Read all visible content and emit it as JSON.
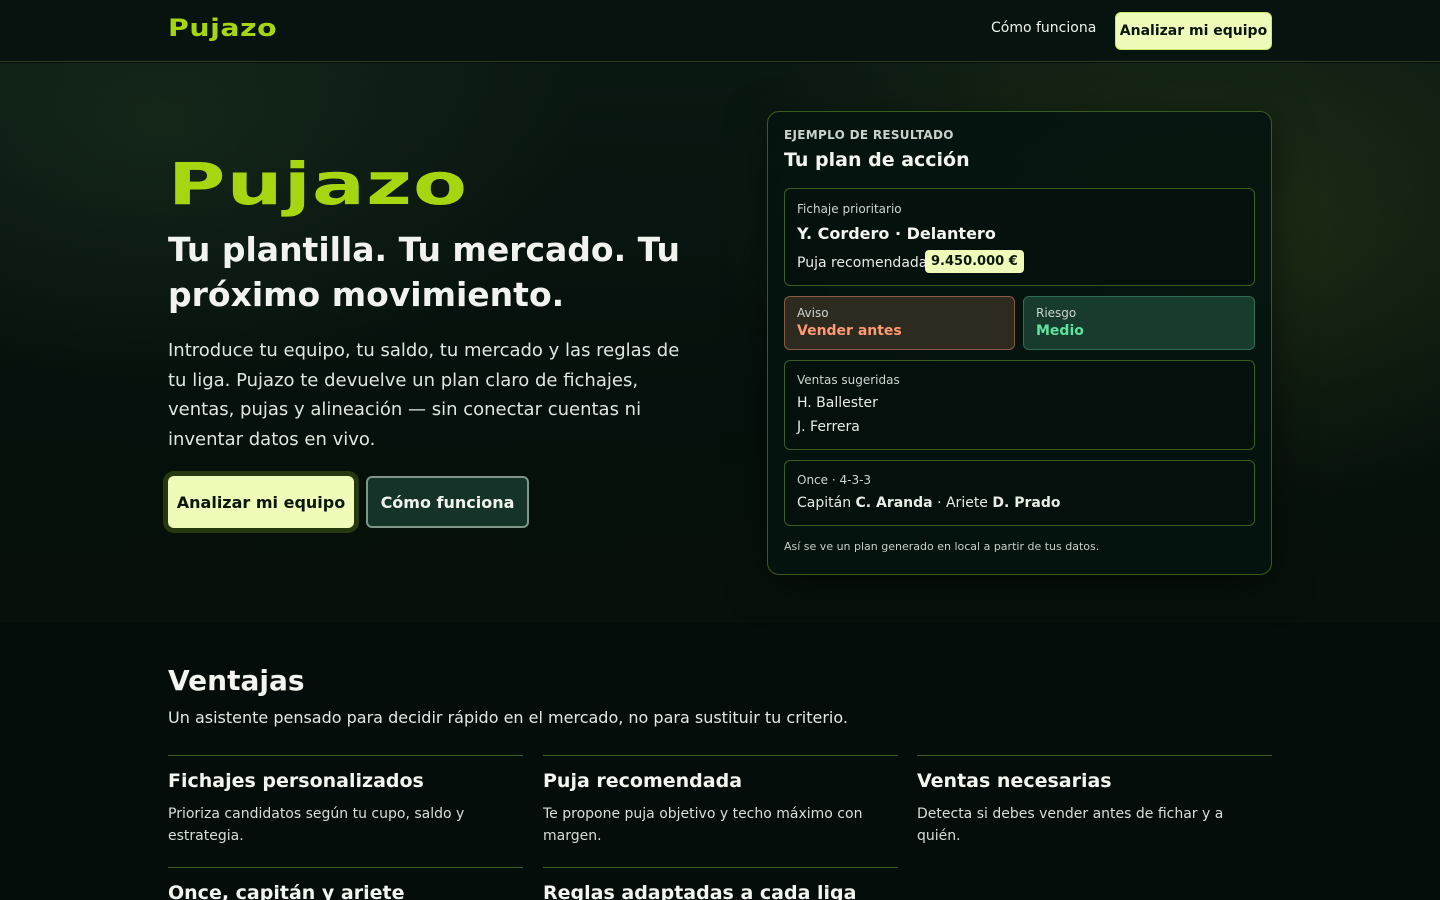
{
  "brand": {
    "name": "Pujazo",
    "accent": "#a6d60f",
    "cta_bg": "#eefbb9"
  },
  "nav": {
    "link_how": "Cómo funciona",
    "cta": "Analizar mi equipo"
  },
  "hero": {
    "logo": "Pujazo",
    "headline": "Tu plantilla. Tu mercado. Tu próximo movimiento.",
    "lead": "Introduce tu equipo, tu saldo, tu mercado y las reglas de tu liga. Pujazo te devuelve un plan claro de fichajes, ventas, pujas y alineación — sin conectar cuentas ni inventar datos en vivo.",
    "primary_button": "Analizar mi equipo",
    "secondary_button": "Cómo funciona"
  },
  "result_card": {
    "eyebrow": "EJEMPLO DE RESULTADO",
    "title": "Tu plan de acción",
    "priority": {
      "label": "Fichaje prioritario",
      "player": "Y. Cordero · Delantero",
      "bid_label": "Puja recomendada",
      "bid_value": "9.450.000 €"
    },
    "warning": {
      "label": "Aviso",
      "value": "Vender antes",
      "color": "#ff9a72"
    },
    "risk": {
      "label": "Riesgo",
      "value": "Medio",
      "color": "#5fe3a0"
    },
    "sales": {
      "label": "Ventas sugeridas",
      "items": [
        "H. Ballester",
        "J. Ferrera"
      ]
    },
    "lineup": {
      "label": "Once · 4-3-3",
      "captain_label": "Capitán",
      "captain": "C. Aranda",
      "separator": "·",
      "striker_label": "Ariete",
      "striker": "D. Prado"
    },
    "footnote": "Así se ve un plan generado en local a partir de tus datos."
  },
  "ventajas": {
    "title": "Ventajas",
    "subtitle": "Un asistente pensado para decidir rápido en el mercado, no para sustituir tu criterio.",
    "features": [
      {
        "title": "Fichajes personalizados",
        "desc": "Prioriza candidatos según tu cupo, saldo y estrategia."
      },
      {
        "title": "Puja recomendada",
        "desc": "Te propone puja objetivo y techo máximo con margen."
      },
      {
        "title": "Ventas necesarias",
        "desc": "Detecta si debes vender antes de fichar y a quién."
      },
      {
        "title": "Once, capitán y ariete",
        "desc": ""
      },
      {
        "title": "Reglas adaptadas a cada liga",
        "desc": ""
      }
    ]
  }
}
